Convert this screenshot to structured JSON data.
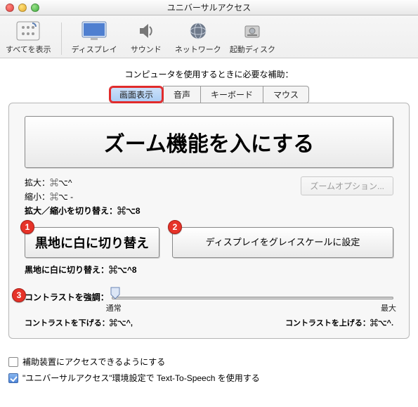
{
  "window": {
    "title": "ユニバーサルアクセス"
  },
  "toolbar": {
    "show_all": "すべてを表示",
    "display": "ディスプレイ",
    "sound": "サウンド",
    "network": "ネットワーク",
    "startup_disk": "起動ディスク"
  },
  "subtitle": "コンピュータを使用するときに必要な補助：",
  "tabs": {
    "screen": "画面表示",
    "voice": "音声",
    "keyboard": "キーボード",
    "mouse": "マウス"
  },
  "zoom": {
    "toggle_label": "ズーム機能を入にする",
    "zoom_in": "拡大：⌘⌥^",
    "zoom_out": "縮小：⌘⌥ -",
    "zoom_tog": "拡大／縮小を切り替え：⌘⌥8",
    "options_button": "ズームオプション..."
  },
  "invert": {
    "button": "黒地に白に切り替え",
    "grayscale_button": "ディスプレイをグレイスケールに設定",
    "shortcut": "黒地に白に切り替え：⌘⌥^8"
  },
  "contrast": {
    "label": "コントラストを強調：",
    "tick_min": "通常",
    "tick_max": "最大",
    "decrease_hint": "コントラストを下げる：⌘⌥^,",
    "increase_hint": "コントラストを上げる：⌘⌥^."
  },
  "badges": {
    "one": "1",
    "two": "2",
    "three": "3"
  },
  "footer": {
    "allow_assistive": "補助装置にアクセスできるようにする",
    "tts": "\"ユニバーサルアクセス\"環境設定で Text-To-Speech を使用する"
  }
}
